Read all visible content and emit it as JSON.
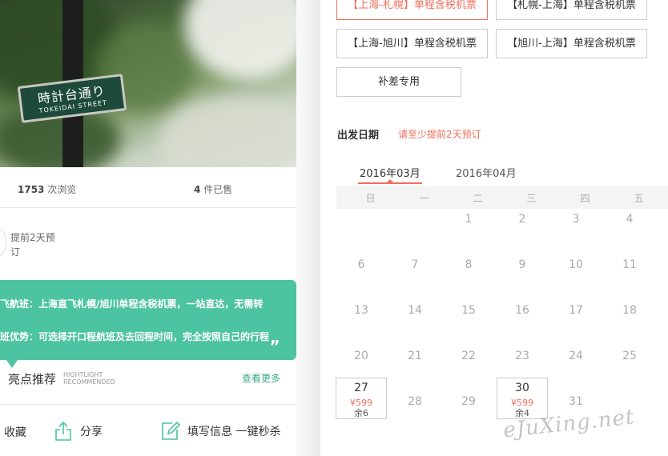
{
  "hero": {
    "sign_jp": "時計台通り",
    "sign_en": "TOKEIDAI STREET"
  },
  "stats": {
    "views_num": "1753",
    "views_label": "次浏览",
    "sold_num": "4",
    "sold_label": "件已售"
  },
  "advance": {
    "line1": "提前2天预",
    "line2": "订"
  },
  "desc": {
    "line1": "飞航班：上海直飞札幌/旭川单程含税机票，一站直达，无需转",
    "line2": "班优势：可选择开口程航班及去回程时间，完全按照自己的行程",
    "quote": "„"
  },
  "highlight": {
    "title": "亮点推荐",
    "en1": "HIGHTLIGHT",
    "en2": "RECOMMENDED",
    "more": "查看更多"
  },
  "bottom": {
    "favorite": "收藏",
    "share": "分享",
    "fill": "填写信息 一键秒杀"
  },
  "products": [
    {
      "label": "【上海-札幌】单程含税机票",
      "selected": true
    },
    {
      "label": "【札幌-上海】单程含税机票",
      "selected": false
    },
    {
      "label": "【上海-旭川】单程含税机票",
      "selected": false
    },
    {
      "label": "【旭川-上海】单程含税机票",
      "selected": false
    },
    {
      "label": "补差专用",
      "selected": false
    }
  ],
  "date": {
    "label": "出发日期",
    "note": "请至少提前2天预订"
  },
  "months": [
    "2016年03月",
    "2016年04月"
  ],
  "weekdays": [
    "日",
    "一",
    "二",
    "三",
    "四",
    "五"
  ],
  "calendar": {
    "rows": [
      [
        "",
        "",
        "1",
        "2",
        "3",
        "4"
      ],
      [
        "6",
        "7",
        "8",
        "9",
        "10",
        "11"
      ],
      [
        "13",
        "14",
        "15",
        "16",
        "17",
        "18"
      ],
      [
        "20",
        "21",
        "22",
        "23",
        "24",
        "25"
      ],
      [
        "27",
        "28",
        "29",
        "30",
        "31",
        ""
      ]
    ],
    "available": {
      "27": {
        "price": "¥599",
        "left": "余6"
      },
      "30": {
        "price": "¥599",
        "left": "余4"
      }
    }
  },
  "watermark": "eJuXing.net",
  "colors": {
    "accent": "#f26d5b",
    "green": "#4cc3a1"
  }
}
